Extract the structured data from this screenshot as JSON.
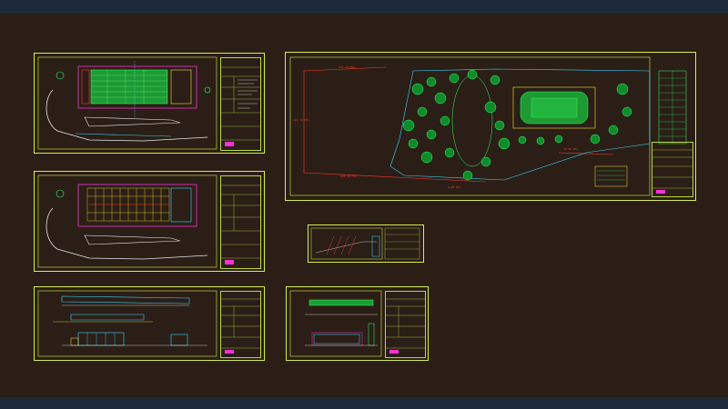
{
  "viewport": {
    "background": "#2a1e16",
    "chrome": "#1c2a3a",
    "sheet_border": "#d7ef4a"
  },
  "sheets": [
    {
      "id": "site-plan-1"
    },
    {
      "id": "floor-plan"
    },
    {
      "id": "elevations"
    },
    {
      "id": "main-site-plan"
    },
    {
      "id": "detail-sheet"
    },
    {
      "id": "section-sheet"
    }
  ],
  "annotations": {
    "dimension_top": "224.14 Mts",
    "dimension_left": "124.74 Mts",
    "dimension_bottom": "200.44 Mts",
    "dimension_right": "76.60 Mts",
    "dimension_small": "4.48 Mts"
  }
}
